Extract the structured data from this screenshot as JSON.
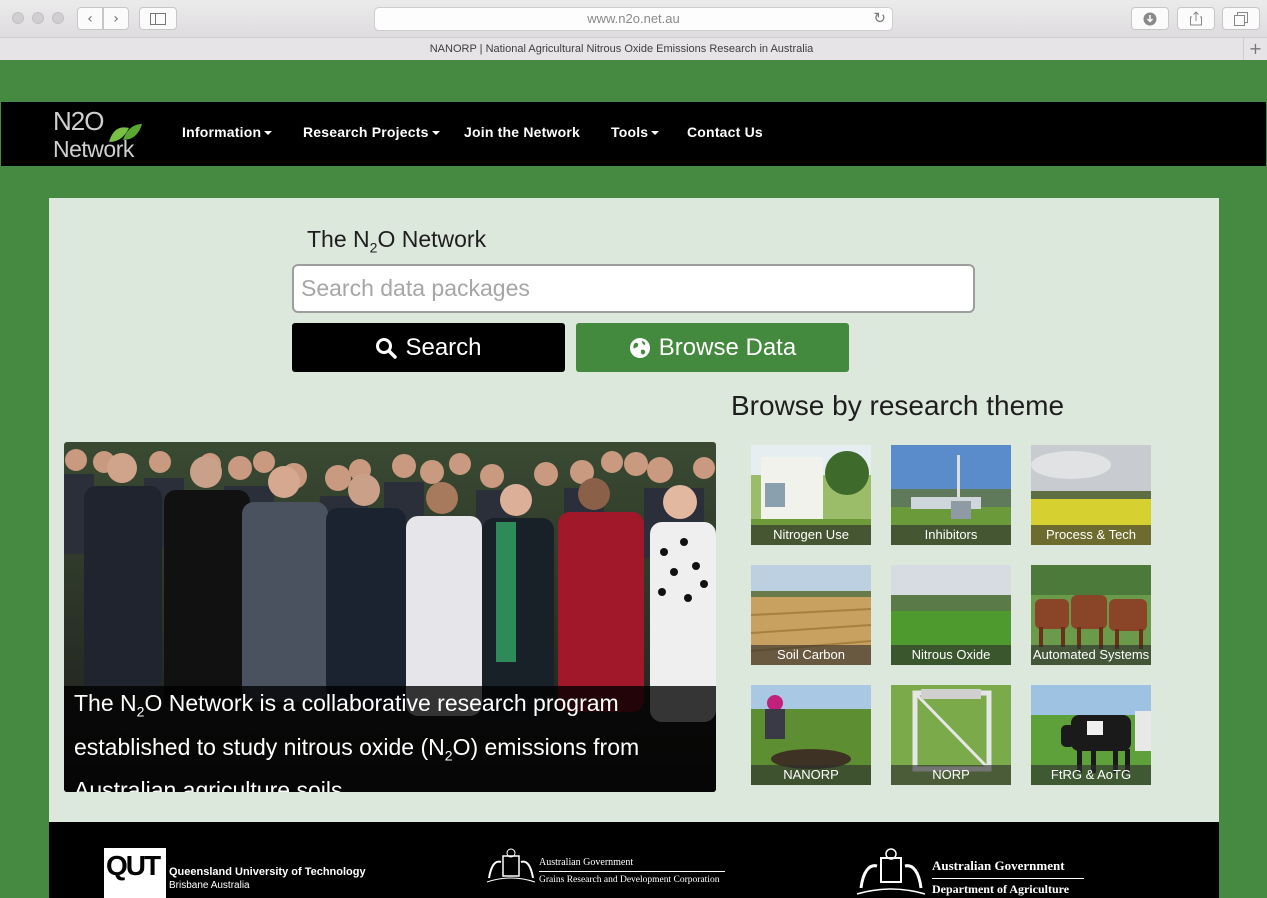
{
  "browser": {
    "url": "www.n2o.net.au",
    "tab_title": "NANORP | National Agricultural Nitrous Oxide Emissions Research in Australia"
  },
  "nav": {
    "logo_top": "N2O",
    "logo_bottom": "Network",
    "items": [
      {
        "label": "Information",
        "dropdown": true
      },
      {
        "label": "Research Projects",
        "dropdown": true
      },
      {
        "label": "Join the Network",
        "dropdown": false
      },
      {
        "label": "Tools",
        "dropdown": true
      },
      {
        "label": "Contact Us",
        "dropdown": false
      }
    ]
  },
  "main": {
    "title_prefix": "The N",
    "title_sub": "2",
    "title_suffix": "O Network",
    "search_placeholder": "Search data packages",
    "search_button": "Search",
    "browse_button": "Browse Data",
    "caption_1": "The N",
    "caption_sub1": "2",
    "caption_2": "O Network is a collaborative research program",
    "caption_3": "established to study nitrous oxide (N",
    "caption_sub2": "2",
    "caption_4": "O) emissions from",
    "caption_5": "Australian agriculture soils.",
    "theme_heading": "Browse by research theme",
    "themes": [
      {
        "label": "Nitrogen Use"
      },
      {
        "label": "Inhibitors"
      },
      {
        "label": "Process & Tech"
      },
      {
        "label": "Soil Carbon"
      },
      {
        "label": "Nitrous Oxide"
      },
      {
        "label": "Automated Systems"
      },
      {
        "label": "NANORP"
      },
      {
        "label": "NORP"
      },
      {
        "label": "FtRG & AoTG"
      }
    ]
  },
  "footer": {
    "qut_mark": "QUT",
    "qut_name": "Queensland University of Technology",
    "qut_place": "Brisbane Australia",
    "grdc_gov": "Australian Government",
    "grdc_name": "Grains Research and Development Corporation",
    "agri_gov": "Australian Government",
    "agri_name": "Department of Agriculture"
  },
  "colors": {
    "page_green": "#468a41",
    "button_green": "#43893e",
    "panel_bg": "#dde8dc",
    "nav_bg": "#000000"
  }
}
